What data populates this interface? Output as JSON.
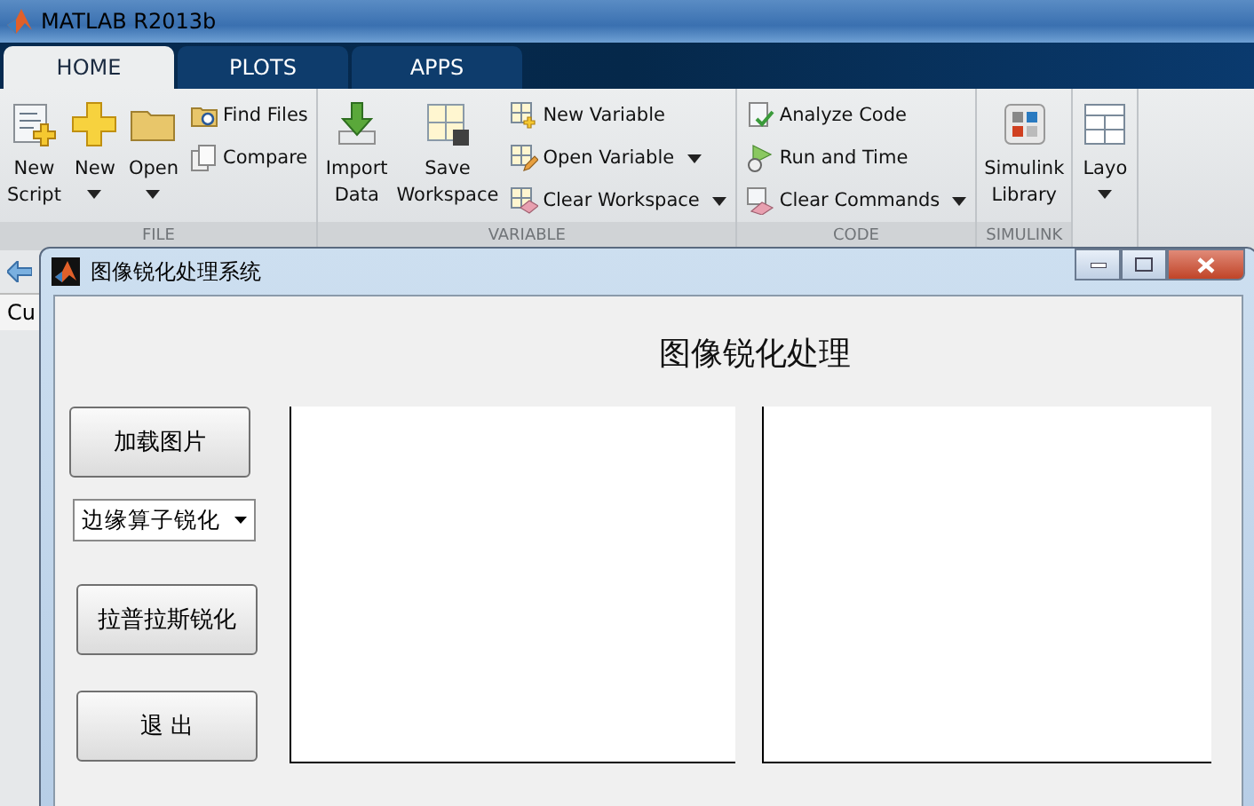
{
  "main_window": {
    "title": "MATLAB R2013b"
  },
  "ribbon_tabs": [
    {
      "label": "HOME",
      "selected": true
    },
    {
      "label": "PLOTS",
      "selected": false
    },
    {
      "label": "APPS",
      "selected": false
    }
  ],
  "ribbon_groups": [
    {
      "label": "FILE",
      "items": [
        {
          "kind": "large",
          "lines": [
            "New",
            "Script"
          ],
          "has_menu": false
        },
        {
          "kind": "large",
          "lines": [
            "New"
          ],
          "has_menu": true
        },
        {
          "kind": "large",
          "lines": [
            "Open"
          ],
          "has_menu": true
        },
        {
          "kind": "column",
          "entries": [
            {
              "label": "Find Files",
              "has_menu": false
            },
            {
              "label": "Compare",
              "has_menu": false
            }
          ]
        }
      ]
    },
    {
      "label": "VARIABLE",
      "items": [
        {
          "kind": "large",
          "lines": [
            "Import",
            "Data"
          ],
          "has_menu": false
        },
        {
          "kind": "large",
          "lines": [
            "Save",
            "Workspace"
          ],
          "has_menu": false
        },
        {
          "kind": "column",
          "entries": [
            {
              "label": "New Variable",
              "has_menu": false
            },
            {
              "label": "Open Variable",
              "has_menu": true
            },
            {
              "label": "Clear Workspace",
              "has_menu": true
            }
          ]
        }
      ]
    },
    {
      "label": "CODE",
      "items": [
        {
          "kind": "column",
          "entries": [
            {
              "label": "Analyze Code",
              "has_menu": false
            },
            {
              "label": "Run and Time",
              "has_menu": false
            },
            {
              "label": "Clear Commands",
              "has_menu": true
            }
          ]
        }
      ]
    },
    {
      "label": "SIMULINK",
      "items": [
        {
          "kind": "large",
          "lines": [
            "Simulink",
            "Library"
          ],
          "has_menu": false
        }
      ]
    },
    {
      "items": [
        {
          "kind": "large",
          "lines": [
            "Layo"
          ],
          "has_menu": true
        }
      ]
    }
  ],
  "desktop": {
    "panel_label": "Cu"
  },
  "dialog": {
    "title": "图像锐化处理系统",
    "heading": "图像锐化处理",
    "controls": [
      {
        "kind": "button",
        "label": "加载图片"
      },
      {
        "kind": "popup",
        "value": "边缘算子锐化"
      },
      {
        "kind": "button",
        "label": "拉普拉斯锐化"
      },
      {
        "kind": "button",
        "label": "退 出"
      }
    ]
  }
}
